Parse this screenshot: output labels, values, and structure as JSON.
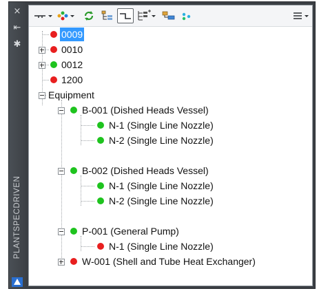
{
  "panel": {
    "title": "PLANTSPECDRIVEN",
    "strip_buttons": {
      "close": "×",
      "pin": "⇤",
      "settings": "✱"
    },
    "colors": {
      "red": "#e81f1f",
      "green": "#1ec31e",
      "selection": "#3399ff"
    }
  },
  "toolbar": {
    "icons": [
      "connect-filter-icon",
      "color-filter-icon",
      "refresh-icon",
      "tree-layout-icon",
      "line-view-icon",
      "expand-all-icon",
      "group-icon",
      "dots-icon",
      "menu-icon"
    ]
  },
  "tree": {
    "items": [
      {
        "label": "0009",
        "status": "red",
        "selected": true,
        "expander": "none"
      },
      {
        "label": "0010",
        "status": "red",
        "expander": "plus"
      },
      {
        "label": "0012",
        "status": "green",
        "expander": "plus"
      },
      {
        "label": "1200",
        "status": "red",
        "expander": "none"
      },
      {
        "label": "Equipment",
        "expander": "minus"
      },
      {
        "label": "B-001 (Dished Heads Vessel)",
        "status": "green",
        "expander": "minus"
      },
      {
        "label": "N-1 (Single Line Nozzle)",
        "status": "green"
      },
      {
        "label": "N-2 (Single Line Nozzle)",
        "status": "green"
      },
      {
        "label": "B-002 (Dished Heads Vessel)",
        "status": "green",
        "expander": "minus"
      },
      {
        "label": "N-1 (Single Line Nozzle)",
        "status": "green"
      },
      {
        "label": "N-2 (Single Line Nozzle)",
        "status": "green"
      },
      {
        "label": "P-001 (General Pump)",
        "status": "green",
        "expander": "minus"
      },
      {
        "label": "N-1 (Single Line Nozzle)",
        "status": "red"
      },
      {
        "label": "W-001 (Shell and Tube Heat Exchanger)",
        "status": "red",
        "expander": "plus"
      }
    ]
  }
}
